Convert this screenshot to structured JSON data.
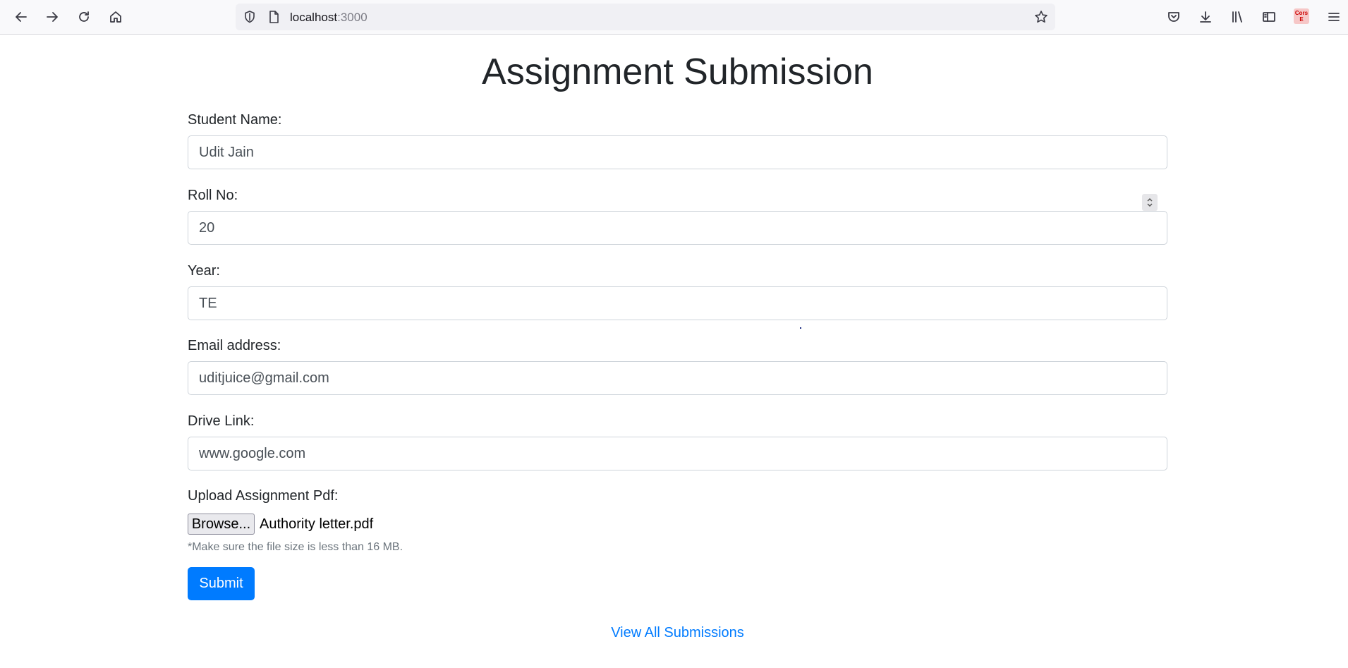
{
  "browser": {
    "url_host": "localhost",
    "url_port": ":3000",
    "extension_label": "Cors E"
  },
  "page": {
    "title": "Assignment Submission"
  },
  "form": {
    "student_name": {
      "label": "Student Name:",
      "value": "Udit Jain"
    },
    "roll_no": {
      "label": "Roll No:",
      "value": "20"
    },
    "year": {
      "label": "Year:",
      "value": "TE"
    },
    "email": {
      "label": "Email address:",
      "value": "uditjuice@gmail.com"
    },
    "drive_link": {
      "label": "Drive Link:",
      "value": "www.google.com"
    },
    "upload": {
      "label": "Upload Assignment Pdf:",
      "browse_label": "Browse...",
      "file_name": "Authority letter.pdf",
      "help": "*Make sure the file size is less than 16 MB."
    },
    "submit_label": "Submit"
  },
  "footer": {
    "view_all_label": "View All Submissions"
  },
  "colors": {
    "primary": "#007bff",
    "text": "#212529",
    "muted": "#6c757d"
  }
}
